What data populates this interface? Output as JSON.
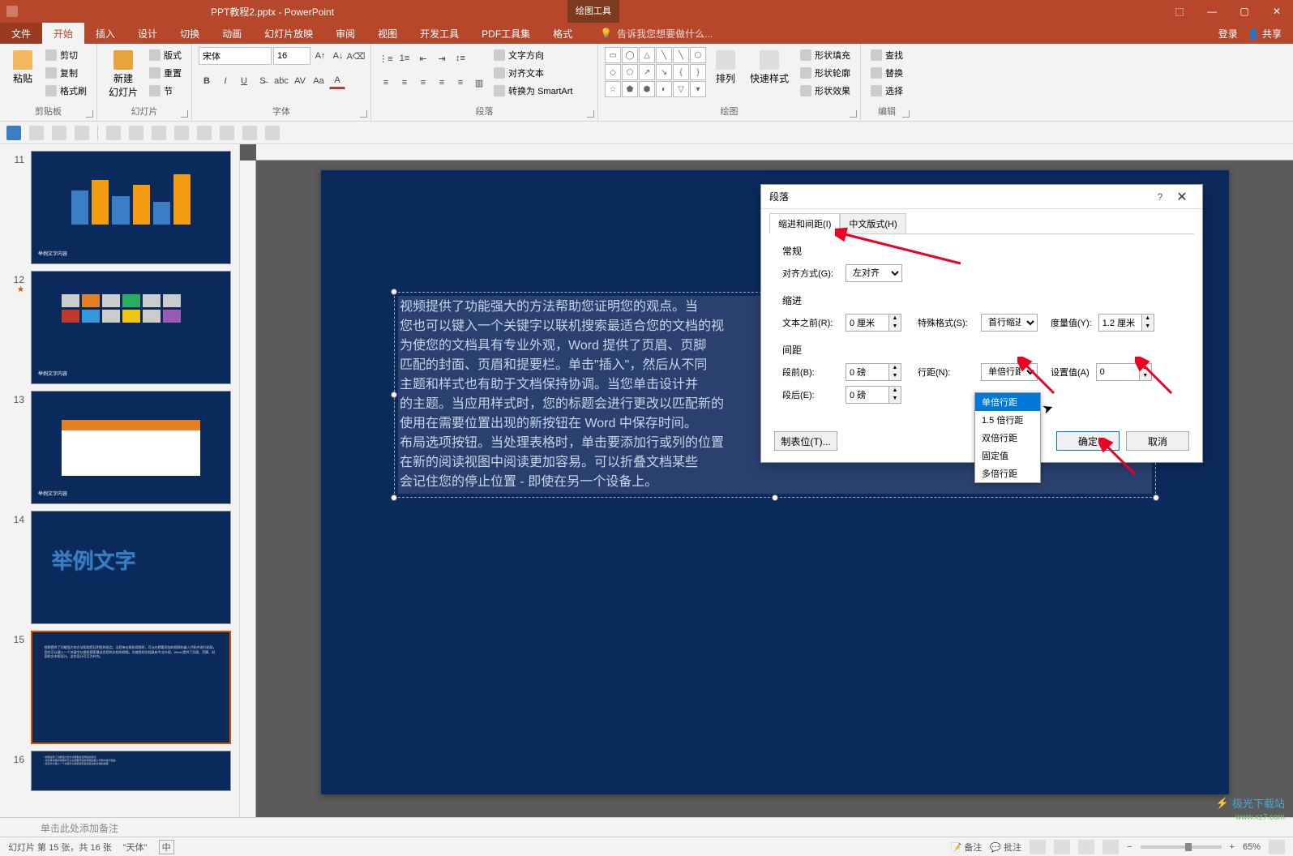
{
  "title": {
    "file": "PPT教程2.pptx - PowerPoint",
    "context_tab": "绘图工具"
  },
  "window_controls": {
    "min": "—",
    "max": "▢",
    "close": "✕",
    "opts": "⬚"
  },
  "menu": {
    "file": "文件",
    "home": "开始",
    "insert": "插入",
    "design": "设计",
    "transitions": "切换",
    "animations": "动画",
    "slideshow": "幻灯片放映",
    "review": "审阅",
    "view": "视图",
    "developer": "开发工具",
    "pdf": "PDF工具集",
    "format": "格式",
    "tell_me": "告诉我您想要做什么...",
    "login": "登录",
    "share": "共享"
  },
  "ribbon": {
    "clipboard": {
      "paste": "粘贴",
      "cut": "剪切",
      "copy": "复制",
      "format_painter": "格式刷",
      "label": "剪贴板"
    },
    "slides": {
      "new_slide": "新建\n幻灯片",
      "layout": "版式",
      "reset": "重置",
      "section": "节",
      "label": "幻灯片"
    },
    "font": {
      "name": "宋体",
      "size": "16",
      "label": "字体"
    },
    "paragraph": {
      "text_direction": "文字方向",
      "align_text": "对齐文本",
      "smartart": "转换为 SmartArt",
      "label": "段落"
    },
    "drawing": {
      "arrange": "排列",
      "quick_styles": "快速样式",
      "shape_fill": "形状填充",
      "shape_outline": "形状轮廓",
      "shape_effects": "形状效果",
      "label": "绘图"
    },
    "editing": {
      "find": "查找",
      "replace": "替换",
      "select": "选择",
      "label": "编辑"
    }
  },
  "thumbnails": [
    {
      "num": "11"
    },
    {
      "num": "12",
      "star": "★"
    },
    {
      "num": "13"
    },
    {
      "num": "14"
    },
    {
      "num": "15"
    },
    {
      "num": "16"
    }
  ],
  "slide_body_text": "视频提供了功能强大的方法帮助您证明您的观点。当\n您也可以键入一个关键字以联机搜索最适合您的文档的视\n为使您的文档具有专业外观，Word 提供了页眉、页脚\n匹配的封面、页眉和提要栏。单击\"插入\"，然后从不同\n主题和样式也有助于文档保持协调。当您单击设计并\n的主题。当应用样式时，您的标题会进行更改以匹配新的\n使用在需要位置出现的新按钮在 Word 中保存时间。\n布局选项按钮。当处理表格时，单击要添加行或列的位置\n在新的阅读视图中阅读更加容易。可以折叠文档某些\n会记住您的停止位置 - 即使在另一个设备上。",
  "dialog": {
    "title": "段落",
    "tabs": {
      "indent": "缩进和间距(I)",
      "asian": "中文版式(H)"
    },
    "general": {
      "title": "常规",
      "align_label": "对齐方式(G):",
      "align_value": "左对齐"
    },
    "indent": {
      "title": "缩进",
      "before_label": "文本之前(R):",
      "before_value": "0 厘米",
      "special_label": "特殊格式(S):",
      "special_value": "首行缩进",
      "by_label": "度量值(Y):",
      "by_value": "1.2 厘米"
    },
    "spacing": {
      "title": "间距",
      "before_label": "段前(B):",
      "before_value": "0 磅",
      "after_label": "段后(E):",
      "after_value": "0 磅",
      "line_label": "行距(N):",
      "line_value": "单倍行距",
      "at_label": "设置值(A)",
      "at_value": "0"
    },
    "dropdown": {
      "items": [
        "单倍行距",
        "1.5 倍行距",
        "双倍行距",
        "固定值",
        "多倍行距"
      ]
    },
    "tabs_btn": "制表位(T)...",
    "ok": "确定",
    "cancel": "取消"
  },
  "notes": "单击此处添加备注",
  "status": {
    "slide_info": "幻灯片 第 15 张，共 16 张",
    "lang": "\"天体\"",
    "chinese": "中",
    "notes_label": "备注",
    "comments_label": "批注",
    "zoom": "65%"
  },
  "watermark": {
    "name": "极光下载站",
    "url": "www.xz7.com"
  }
}
